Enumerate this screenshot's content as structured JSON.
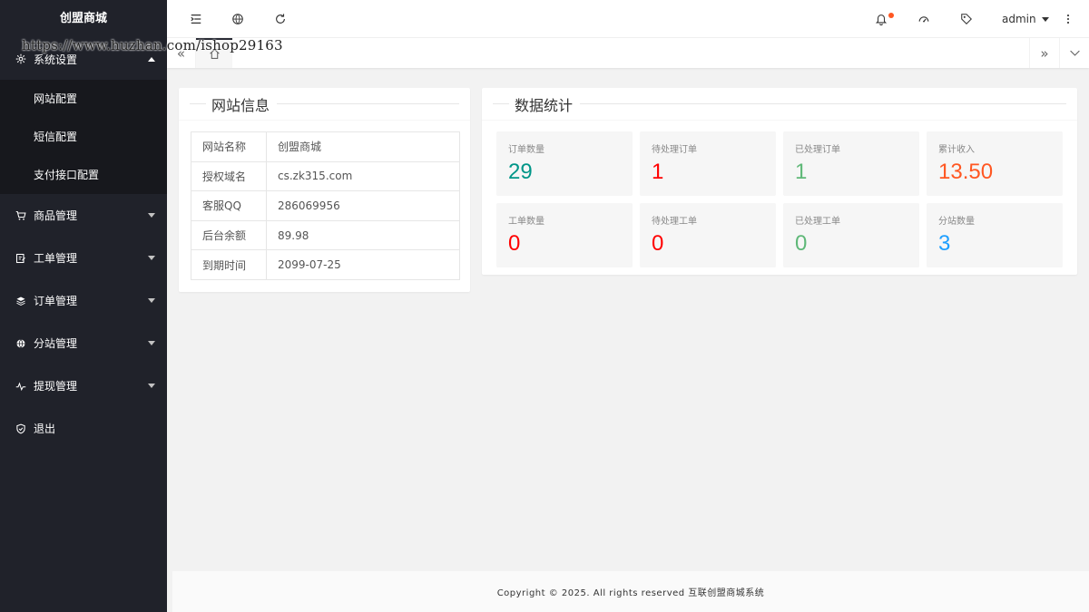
{
  "app": {
    "logo_text": "创盟商城"
  },
  "watermark": "https://www.huzhan.com/ishop29163",
  "sidebar": {
    "groups": [
      {
        "label": "系统设置",
        "icon": "gear-icon",
        "open": true,
        "items": [
          {
            "label": "网站配置"
          },
          {
            "label": "短信配置"
          },
          {
            "label": "支付接口配置"
          }
        ]
      },
      {
        "label": "商品管理",
        "icon": "cart-icon"
      },
      {
        "label": "工单管理",
        "icon": "ticket-icon"
      },
      {
        "label": "订单管理",
        "icon": "layers-icon"
      },
      {
        "label": "分站管理",
        "icon": "globe-icon"
      },
      {
        "label": "提现管理",
        "icon": "pulse-icon"
      },
      {
        "label": "退出",
        "icon": "shield-icon"
      }
    ]
  },
  "header": {
    "user": "admin",
    "accent_dot_color": "#ff5722"
  },
  "site_info": {
    "title": "网站信息",
    "rows": [
      {
        "key": "网站名称",
        "value": "创盟商城"
      },
      {
        "key": "授权域名",
        "value": "cs.zk315.com"
      },
      {
        "key": "客服QQ",
        "value": "286069956"
      },
      {
        "key": "后台余额",
        "value": "89.98"
      },
      {
        "key": "到期时间",
        "value": "2099-07-25"
      }
    ]
  },
  "stats": {
    "title": "数据统计",
    "items": [
      {
        "label": "订单数量",
        "value": "29",
        "color": "#009688"
      },
      {
        "label": "待处理订单",
        "value": "1",
        "color": "#ff0000"
      },
      {
        "label": "已处理订单",
        "value": "1",
        "color": "#5fb878"
      },
      {
        "label": "累计收入",
        "value": "13.50",
        "color": "#ff5722"
      },
      {
        "label": "工单数量",
        "value": "0",
        "color": "#ff0000"
      },
      {
        "label": "待处理工单",
        "value": "0",
        "color": "#ff0000"
      },
      {
        "label": "已处理工单",
        "value": "0",
        "color": "#5fb878"
      },
      {
        "label": "分站数量",
        "value": "3",
        "color": "#1e9fff"
      }
    ]
  },
  "footer": {
    "text": "Copyright © 2025. All rights reserved 互联创盟商城系统"
  }
}
